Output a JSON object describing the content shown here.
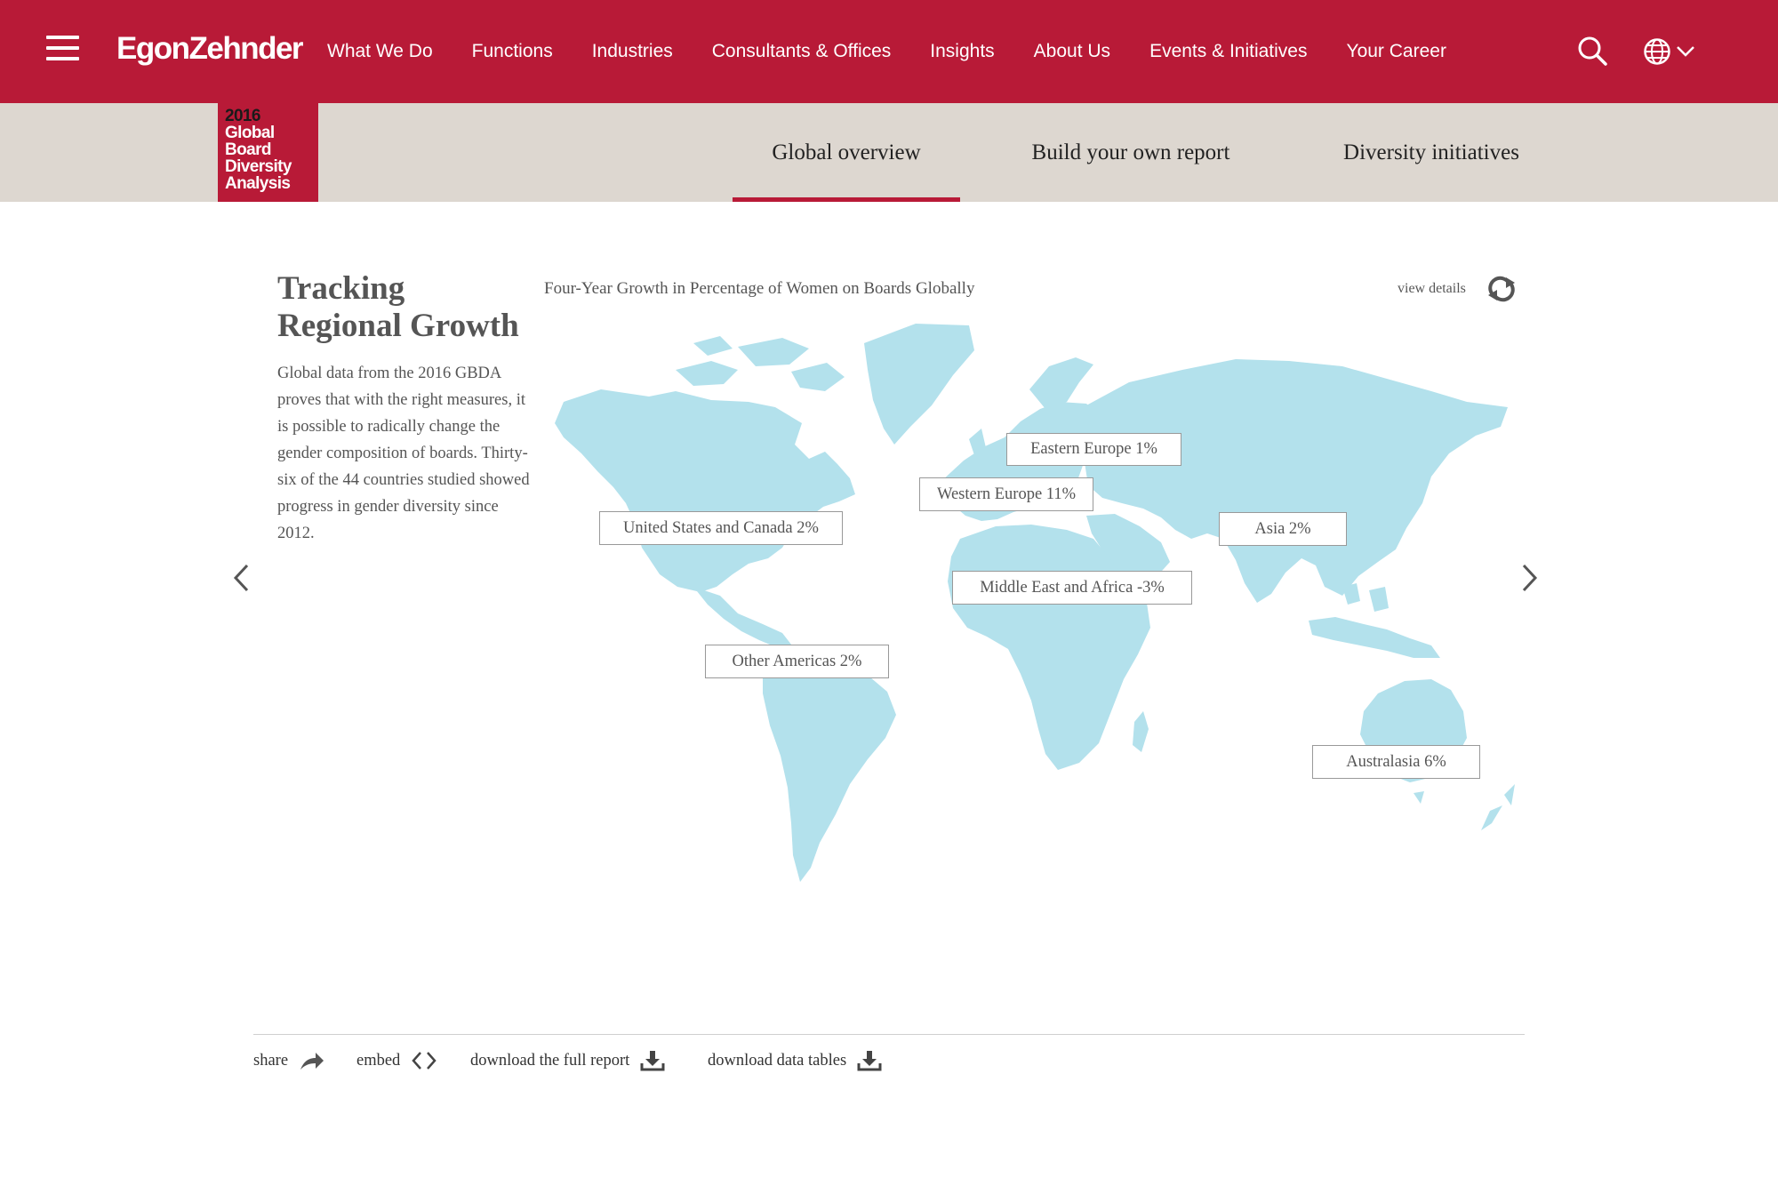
{
  "nav": {
    "logo": "EgonZehnder",
    "links": [
      "What We Do",
      "Functions",
      "Industries",
      "Consultants & Offices",
      "Insights",
      "About Us",
      "Events & Initiatives",
      "Your Career"
    ],
    "icons": [
      "menu-icon",
      "search-icon",
      "globe-icon",
      "chevron-down-icon"
    ]
  },
  "badge": {
    "year": "2016",
    "line1": "Global",
    "line2": "Board",
    "line3": "Diversity",
    "line4": "Analysis"
  },
  "subnav": {
    "tabs": [
      "Global overview",
      "Build your own report",
      "Diversity initiatives"
    ],
    "active_index": 0
  },
  "intro": {
    "title_line1": "Tracking",
    "title_line2": "Regional Growth",
    "body": "Global data from the 2016 GBDA proves that with the right measures, it is possible to radically change the gender composition of boards. Thirty-six of the 44 countries studied showed progress in gender diversity since 2012."
  },
  "chart": {
    "title": "Four-Year Growth in Percentage of Women on Boards Globally",
    "view_details": "view details",
    "map_color": "#b3e1ec",
    "regions": [
      {
        "name": "United States and Canada",
        "value": "2%",
        "label": "United States and Canada 2%"
      },
      {
        "name": "Other Americas",
        "value": "2%",
        "label": "Other Americas 2%"
      },
      {
        "name": "Western Europe",
        "value": "11%",
        "label": "Western Europe 11%"
      },
      {
        "name": "Eastern Europe",
        "value": "1%",
        "label": "Eastern Europe 1%"
      },
      {
        "name": "Middle East and Africa",
        "value": "-3%",
        "label": "Middle East and Africa -3%"
      },
      {
        "name": "Asia",
        "value": "2%",
        "label": "Asia 2%"
      },
      {
        "name": "Australasia",
        "value": "6%",
        "label": "Australasia 6%"
      }
    ]
  },
  "actions": {
    "share": "share",
    "embed": "embed",
    "download_report": "download the full report",
    "download_tables": "download data tables"
  },
  "colors": {
    "brand": "#b81a37",
    "subnav_bg": "#ddd7d0",
    "map": "#b3e1ec"
  }
}
